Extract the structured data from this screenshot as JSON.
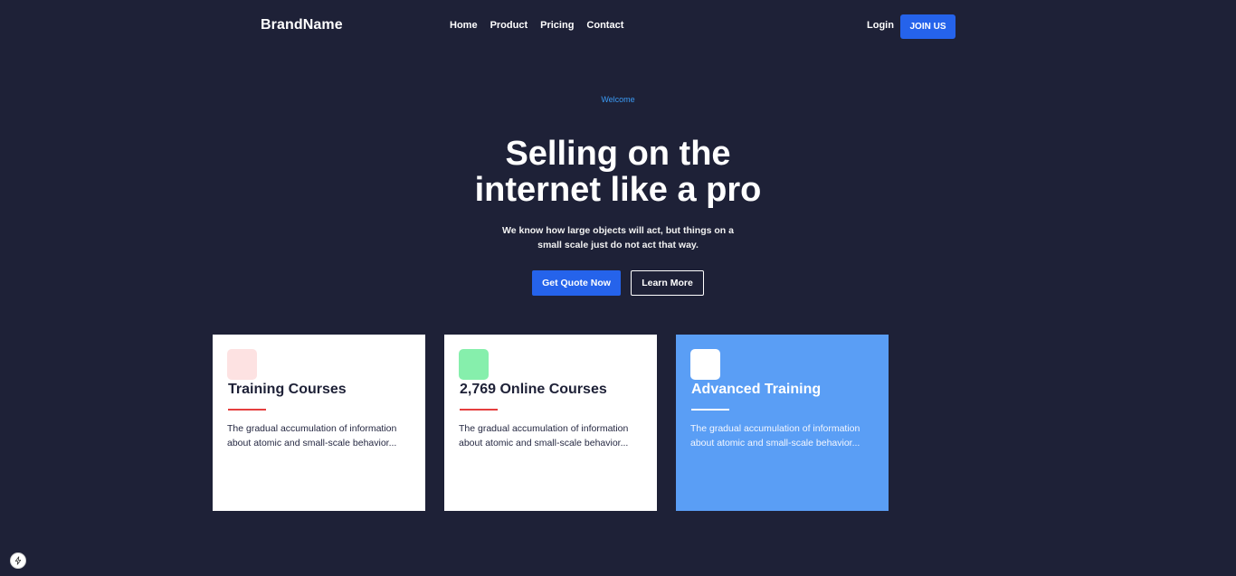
{
  "nav": {
    "brand": "BrandName",
    "links": [
      "Home",
      "Product",
      "Pricing",
      "Contact"
    ],
    "login": "Login",
    "join": "JOIN US"
  },
  "hero": {
    "eyebrow": "Welcome",
    "title_line1": "Selling on the",
    "title_line2": "internet like a pro",
    "subtitle": "We know how large objects will act, but things on a small scale just do not act that way.",
    "primary_button": "Get Quote Now",
    "secondary_button": "Learn More"
  },
  "cards": [
    {
      "title": "Training Courses",
      "text": "The gradual accumulation of information about atomic and small-scale behavior...",
      "icon_color": "#fde2e2"
    },
    {
      "title": "2,769 Online Courses",
      "text": "The gradual accumulation of information about atomic and small-scale behavior...",
      "icon_color": "#86efac"
    },
    {
      "title": "Advanced Training",
      "text": "The gradual accumulation of information about atomic and small-scale behavior...",
      "icon_color": "#ffffff"
    }
  ],
  "colors": {
    "background": "#1e2137",
    "accent": "#2563eb",
    "eyebrow": "#3b9bf5",
    "highlight_card": "#5a9ef5",
    "divider": "#e53e3e"
  },
  "icons": {
    "corner_badge": "bolt-icon"
  }
}
